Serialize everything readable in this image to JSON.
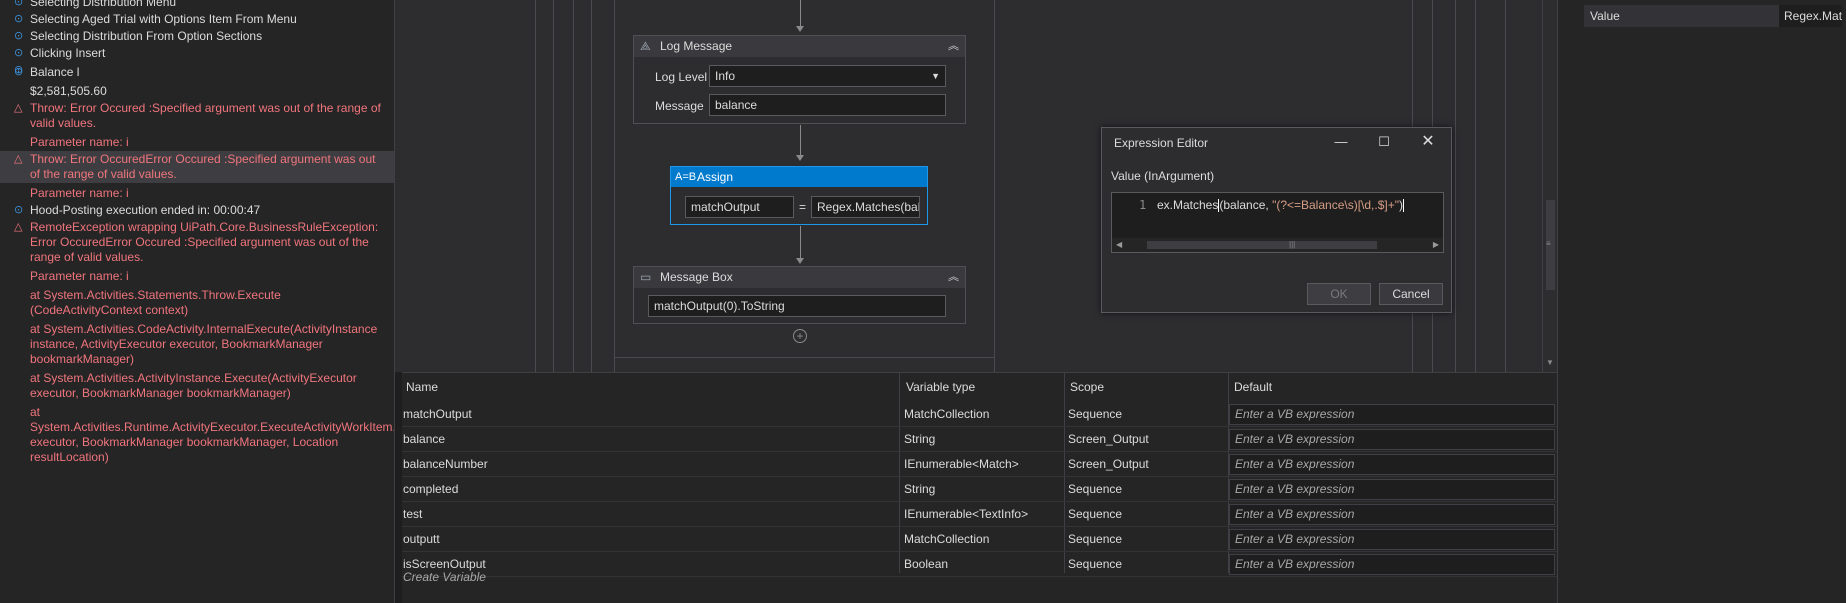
{
  "output_log": [
    {
      "type": "info",
      "text": "Selecting Distribution Menu"
    },
    {
      "type": "info",
      "text": "Selecting Aged Trial with Options Item From Menu"
    },
    {
      "type": "info",
      "text": "Selecting Distribution From Option Sections"
    },
    {
      "type": "info",
      "text": "Clicking Insert"
    },
    {
      "type": "info",
      "text": ""
    },
    {
      "type": "info",
      "text": "Balance l"
    },
    {
      "type": "plain",
      "text": "$2,581,505.60"
    },
    {
      "type": "error",
      "text": "Throw: Error Occured :Specified argument was out of the range of valid values."
    },
    {
      "type": "error-child",
      "text": "Parameter name: i"
    },
    {
      "type": "error-selected",
      "text": "Throw: Error OccuredError Occured :Specified argument was out of the range of valid values."
    },
    {
      "type": "error-child",
      "text": "Parameter name: i"
    },
    {
      "type": "info",
      "text": "Hood-Posting execution ended in: 00:00:47"
    },
    {
      "type": "error",
      "text": "RemoteException wrapping UiPath.Core.BusinessRuleException: Error OccuredError Occured :Specified argument was out of the range of valid values."
    },
    {
      "type": "error-child",
      "text": "Parameter name: i"
    },
    {
      "type": "error-child",
      "text": "   at System.Activities.Statements.Throw.Execute (CodeActivityContext context)"
    },
    {
      "type": "error-child",
      "text": "   at System.Activities.CodeActivity.InternalExecute(ActivityInstance instance, ActivityExecutor executor, BookmarkManager bookmarkManager)"
    },
    {
      "type": "error-child",
      "text": "   at System.Activities.ActivityInstance.Execute(ActivityExecutor executor, BookmarkManager bookmarkManager)"
    },
    {
      "type": "error-child",
      "text": "   at System.Activities.Runtime.ActivityExecutor.ExecuteActivityWorkItem.ExecuteBody(ActivityExecutor executor, BookmarkManager bookmarkManager, Location resultLocation)"
    }
  ],
  "designer": {
    "log_message": {
      "title": "Log Message",
      "level_label": "Log Level",
      "level_value": "Info",
      "message_label": "Message",
      "message_value": "balance"
    },
    "assign": {
      "title": "Assign",
      "to": "matchOutput",
      "equals": "=",
      "value": "Regex.Matches(bal"
    },
    "message_box": {
      "title": "Message Box",
      "text": "matchOutput(0).ToString"
    }
  },
  "variables": {
    "headers": [
      "Name",
      "Variable type",
      "Scope",
      "Default"
    ],
    "rows": [
      {
        "name": "matchOutput",
        "type": "MatchCollection",
        "scope": "Sequence",
        "default": "Enter a VB expression"
      },
      {
        "name": "balance",
        "type": "String",
        "scope": "Screen_Output",
        "default": "Enter a VB expression"
      },
      {
        "name": "balanceNumber",
        "type": "IEnumerable<Match>",
        "scope": "Screen_Output",
        "default": "Enter a VB expression"
      },
      {
        "name": "completed",
        "type": "String",
        "scope": "Sequence",
        "default": "Enter a VB expression"
      },
      {
        "name": "test",
        "type": "IEnumerable<TextInfo>",
        "scope": "Sequence",
        "default": "Enter a VB expression"
      },
      {
        "name": "outputt",
        "type": "MatchCollection",
        "scope": "Sequence",
        "default": "Enter a VB expression"
      },
      {
        "name": "isScreenOutput",
        "type": "Boolean",
        "scope": "Sequence",
        "default": "Enter a VB expression"
      }
    ],
    "create_label": "Create Variable"
  },
  "properties": {
    "label": "Value",
    "value": "Regex.Matches"
  },
  "expression_editor": {
    "title": "Expression Editor",
    "arg_label": "Value (InArgument)",
    "line_number": "1",
    "code_prefix": "ex.Matches",
    "code_mid": "(balance, ",
    "code_string": "\"(?<=Balance\\s)[\\d,.$]+\"",
    "code_suffix": ")",
    "ok_label": "OK",
    "cancel_label": "Cancel"
  },
  "colors": {
    "accent": "#007acc",
    "error": "#f0757c",
    "info": "#3b8fd6"
  }
}
